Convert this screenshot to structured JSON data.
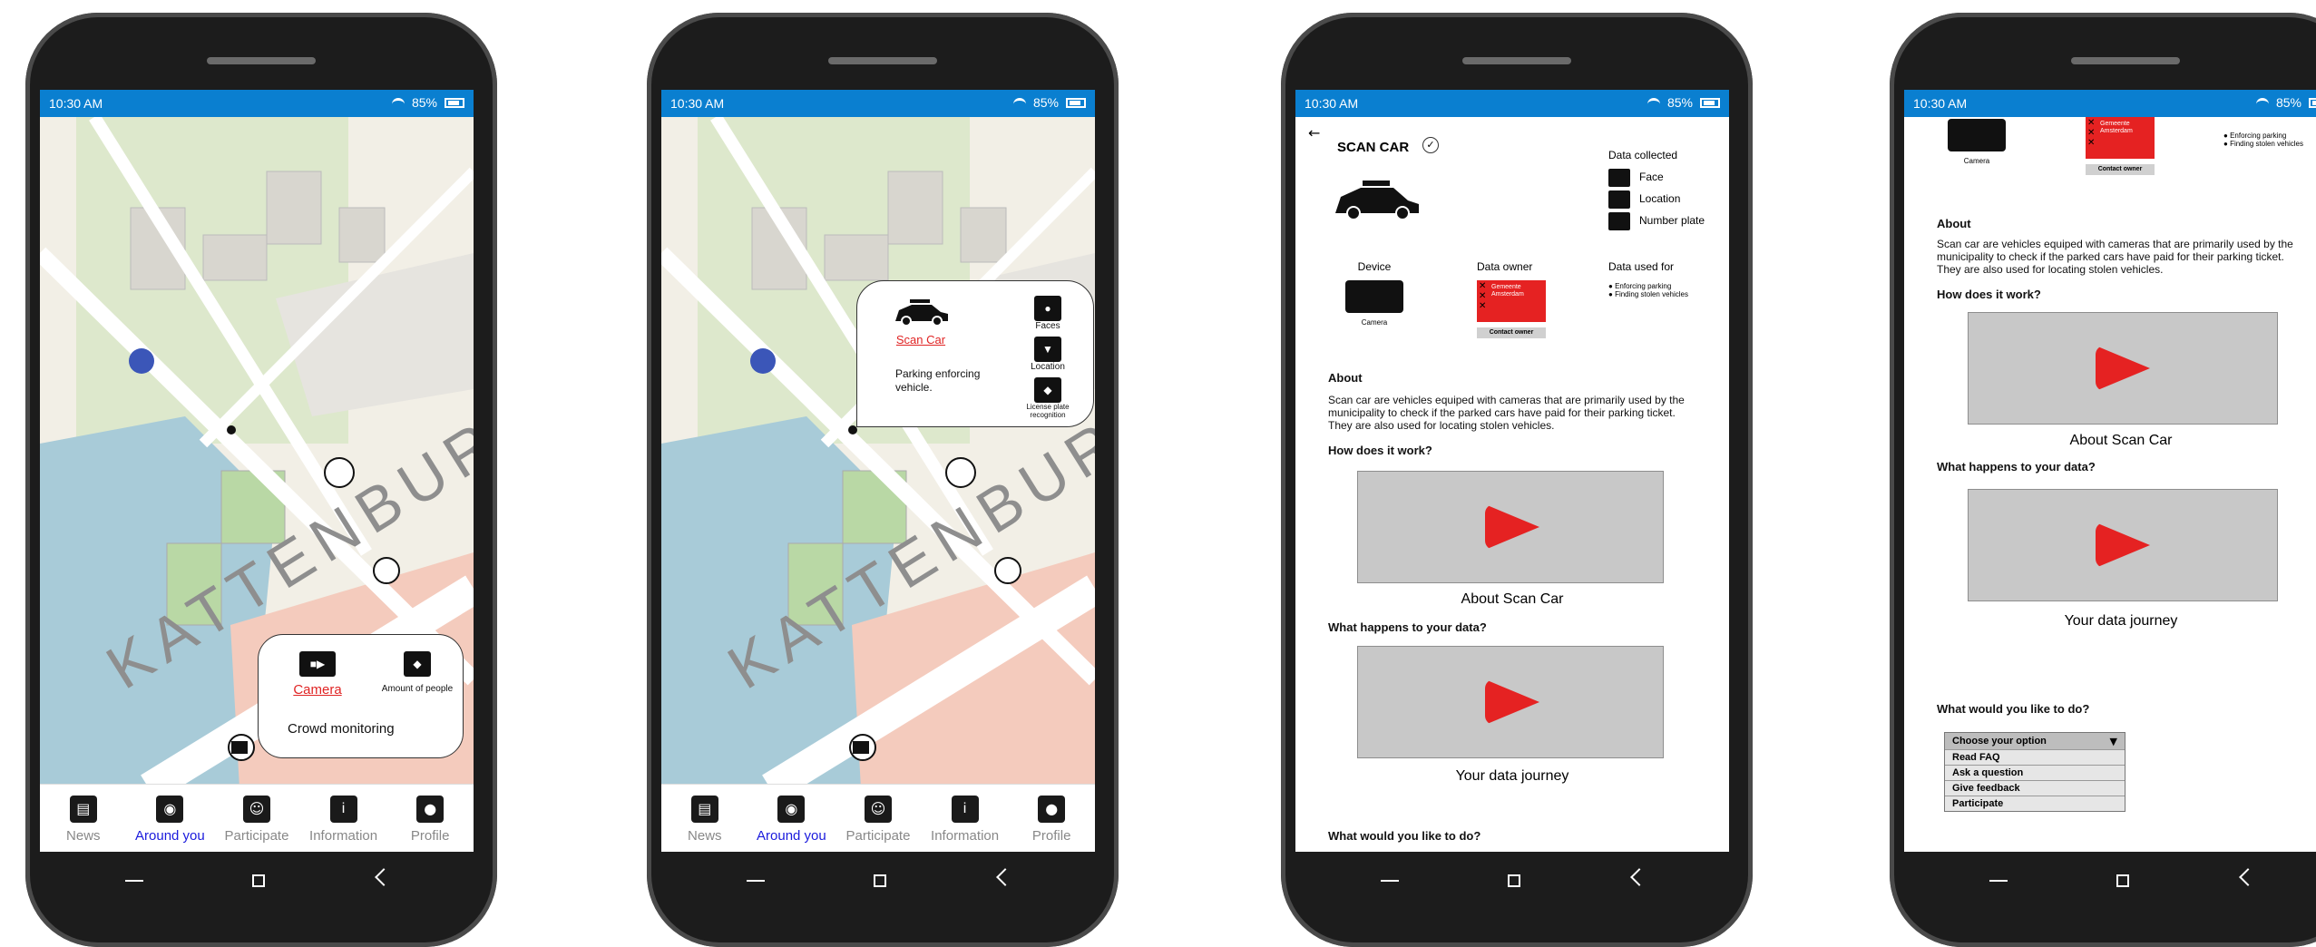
{
  "status": {
    "time": "10:30 AM",
    "battery": "85%"
  },
  "nav": [
    {
      "label": "News",
      "icon": "newspaper-icon"
    },
    {
      "label": "Around you",
      "icon": "broadcast-icon"
    },
    {
      "label": "Participate",
      "icon": "people-icon"
    },
    {
      "label": "Information",
      "icon": "info-icon"
    },
    {
      "label": "Profile",
      "icon": "person-icon"
    }
  ],
  "map": {
    "street_label": "KATTENBURGE"
  },
  "phone1": {
    "popup": {
      "title": "Camera",
      "detail": "Amount of people",
      "description": "Crowd monitoring"
    }
  },
  "phone2": {
    "popup": {
      "title": "Scan Car",
      "description": "Parking enforcing vehicle.",
      "items": [
        "Faces",
        "Location",
        "License plate recognition"
      ]
    }
  },
  "detail": {
    "title": "SCAN CAR",
    "data_collected_title": "Data collected",
    "data_collected": [
      "Face",
      "Location",
      "Number plate"
    ],
    "device_title": "Device",
    "device_label": "Camera",
    "owner_title": "Data owner",
    "owner_name": "Gemeente Amsterdam",
    "contact_owner": "Contact owner",
    "used_for_title": "Data used for",
    "used_for": [
      "Enforcing parking",
      "Finding stolen vehicles"
    ],
    "about_title": "About",
    "about_text": "Scan car are vehicles equiped with cameras that are primarily used by the municipality to check if the parked cars have paid for their parking ticket. They are also used for locating stolen vehicles.",
    "how_title": "How does it work?",
    "video1_caption": "About Scan Car",
    "data_title": "What happens to your data?",
    "video2_caption": "Your data journey",
    "action_title": "What would you like to do?",
    "dropdown_label": "Choose your option",
    "dropdown_options": [
      "Read FAQ",
      "Ask a question",
      "Give feedback",
      "Participate"
    ]
  },
  "colors": {
    "status_bar": "#0a7fd0",
    "accent_red": "#e52222",
    "nav_active": "#1a1adc"
  }
}
